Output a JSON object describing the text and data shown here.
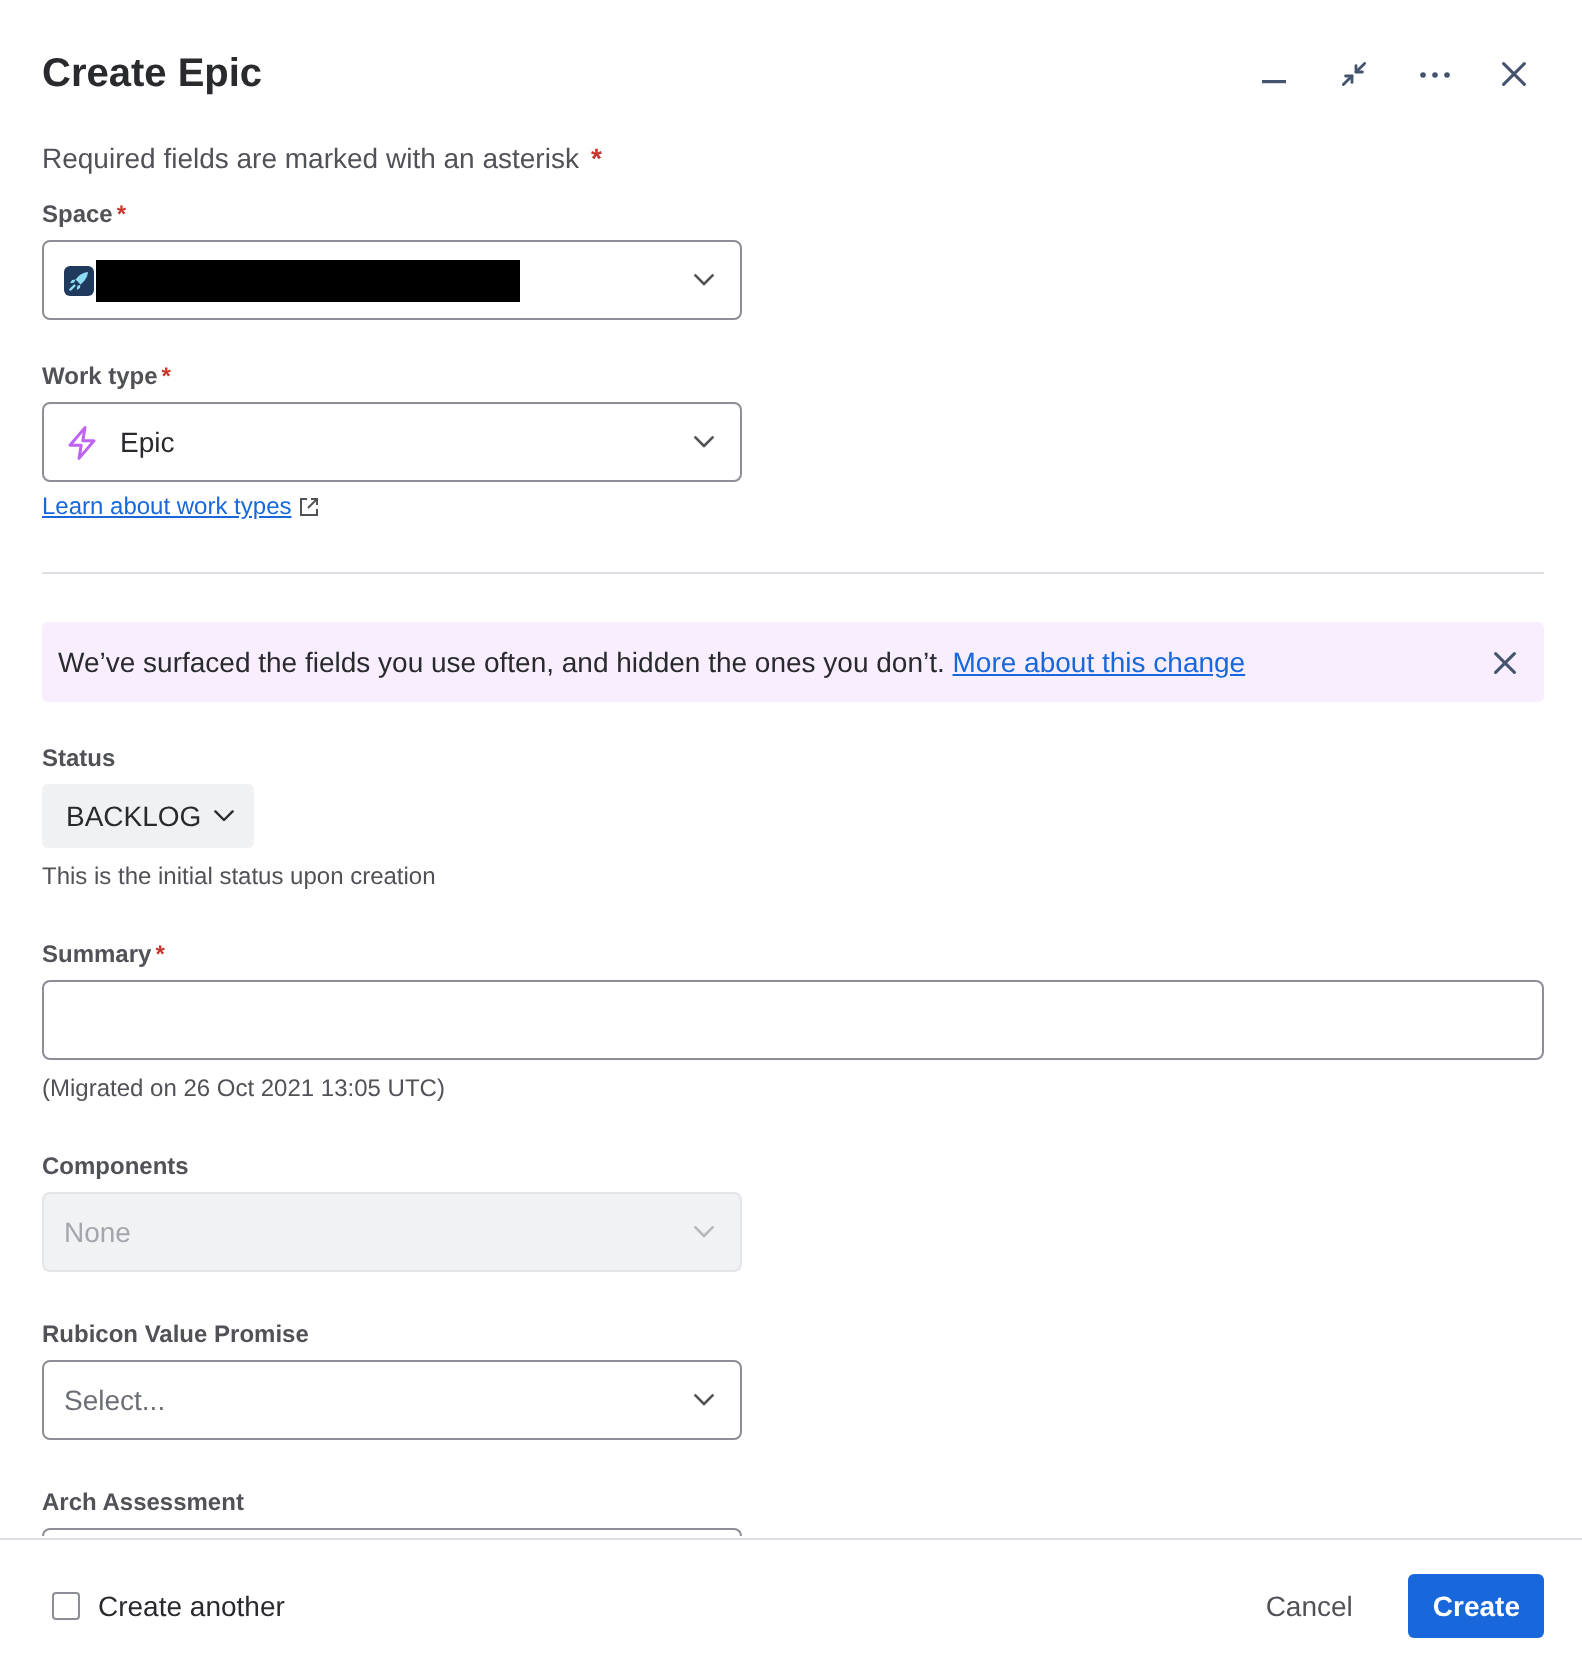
{
  "dialog": {
    "title": "Create Epic"
  },
  "required_note": {
    "text": "Required fields are marked with an asterisk",
    "marker": "*"
  },
  "type_fields": [
    {
      "kind": "space",
      "label": "Space",
      "required_mark": "*",
      "redacted": true
    },
    {
      "kind": "worktype",
      "label": "Work type",
      "required_mark": "*",
      "value": "Epic",
      "link": "Learn about work types"
    }
  ],
  "banner": {
    "message": "We’ve surfaced the fields you use often, and hidden the ones you don’t.",
    "link": "More about this change"
  },
  "fields": [
    {
      "kind": "status",
      "label": "Status",
      "value": "BACKLOG",
      "help": "This is the initial status upon creation",
      "disabled": false
    },
    {
      "kind": "text",
      "label": "Summary",
      "required_mark": "*",
      "help": "(Migrated on 26 Oct 2021 13:05 UTC)",
      "disabled": false
    },
    {
      "kind": "select",
      "label": "Components",
      "value": "None",
      "disabled": true
    },
    {
      "kind": "select",
      "label": "Rubicon Value Promise",
      "placeholder": "Select...",
      "disabled": false
    },
    {
      "kind": "cutoff",
      "label": "Arch Assessment",
      "disabled": false
    }
  ],
  "footer": {
    "create_another": {
      "label": "Create another",
      "checked": false
    },
    "buttons": [
      {
        "label": "Cancel",
        "kind": "subtle"
      },
      {
        "label": "Create",
        "kind": "primary"
      }
    ]
  }
}
